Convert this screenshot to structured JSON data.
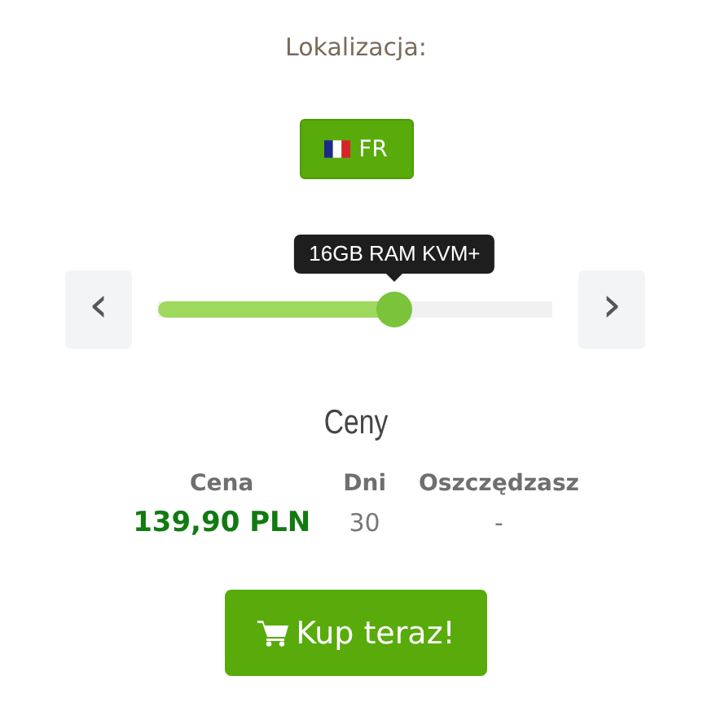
{
  "location": {
    "label": "Lokalizacja:",
    "button": "FR"
  },
  "plan_slider": {
    "tooltip": "16GB RAM KVM+",
    "level": 0.6,
    "prev": "‹",
    "next": "›"
  },
  "prices": {
    "title": "Ceny",
    "columns": [
      "Cena",
      "Dni",
      "Oszczędzasz"
    ],
    "rows": [
      {
        "cells": [
          "139,90 PLN",
          "30",
          "-"
        ]
      }
    ]
  },
  "buy_button": "Kup teraz!"
}
